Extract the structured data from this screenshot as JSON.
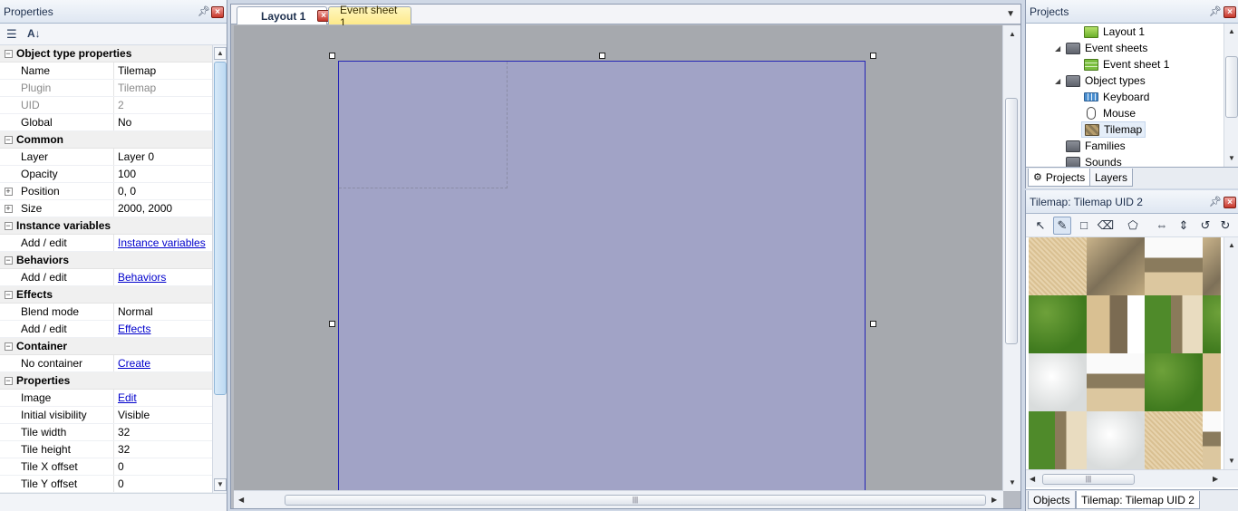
{
  "properties_panel": {
    "title": "Properties",
    "sort_categorized_icon": "☰",
    "sort_alpha_icon": "A↓",
    "categories": [
      {
        "label": "Object type properties",
        "rows": [
          {
            "name": "Name",
            "value": "Tilemap"
          },
          {
            "name": "Plugin",
            "value": "Tilemap"
          },
          {
            "name": "UID",
            "value": "2"
          },
          {
            "name": "Global",
            "value": "No"
          }
        ]
      },
      {
        "label": "Common",
        "rows": [
          {
            "name": "Layer",
            "value": "Layer 0"
          },
          {
            "name": "Opacity",
            "value": "100"
          },
          {
            "name": "Position",
            "value": "0, 0"
          },
          {
            "name": "Size",
            "value": "2000, 2000"
          }
        ]
      },
      {
        "label": "Instance variables",
        "rows": [
          {
            "name": "Add / edit",
            "value": "Instance variables"
          }
        ]
      },
      {
        "label": "Behaviors",
        "rows": [
          {
            "name": "Add / edit",
            "value": "Behaviors"
          }
        ]
      },
      {
        "label": "Effects",
        "rows": [
          {
            "name": "Blend mode",
            "value": "Normal"
          },
          {
            "name": "Add / edit",
            "value": "Effects"
          }
        ]
      },
      {
        "label": "Container",
        "rows": [
          {
            "name": "No container",
            "value": "Create"
          }
        ]
      },
      {
        "label": "Properties",
        "rows": [
          {
            "name": "Image",
            "value": "Edit"
          },
          {
            "name": "Initial visibility",
            "value": "Visible"
          },
          {
            "name": "Tile width",
            "value": "32"
          },
          {
            "name": "Tile height",
            "value": "32"
          },
          {
            "name": "Tile X offset",
            "value": "0"
          },
          {
            "name": "Tile Y offset",
            "value": "0"
          }
        ]
      }
    ]
  },
  "editor": {
    "tabs": [
      {
        "label": "Layout 1"
      },
      {
        "label": "Event sheet 1"
      }
    ]
  },
  "projects_panel": {
    "title": "Projects",
    "tree": {
      "layout1": "Layout 1",
      "event_sheets": "Event sheets",
      "event_sheet1": "Event sheet 1",
      "object_types": "Object types",
      "keyboard": "Keyboard",
      "mouse": "Mouse",
      "tilemap": "Tilemap",
      "families": "Families",
      "sounds": "Sounds"
    },
    "tabs": [
      "Projects",
      "Layers"
    ]
  },
  "tilemap_panel": {
    "title": "Tilemap: Tilemap UID 2",
    "tabs": [
      "Objects",
      "Tilemap: Tilemap UID 2"
    ]
  },
  "colors": {
    "selection_border": "#2525b5",
    "tilemap_fill": "#a1a3c6",
    "canvas_bg": "#a6a9ae",
    "event_tab": "#fde98a"
  }
}
